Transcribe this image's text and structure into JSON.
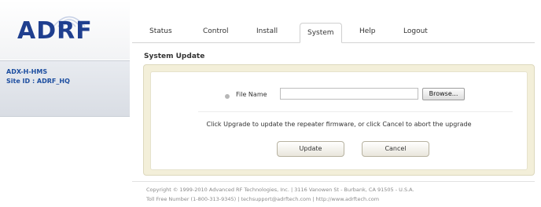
{
  "brand": {
    "logo_text": "ADRF",
    "accent_color": "#1f3f8f"
  },
  "site": {
    "device": "ADX-H-HMS",
    "site_id": "Site ID : ADRF_HQ"
  },
  "tabs": [
    {
      "label": "Status"
    },
    {
      "label": "Control"
    },
    {
      "label": "Install"
    },
    {
      "label": "System",
      "active": true
    },
    {
      "label": "Help"
    },
    {
      "label": "Logout"
    }
  ],
  "page": {
    "section_title": "System Update"
  },
  "update": {
    "file_label": "File Name",
    "file_value": "",
    "browse_label": "Browse...",
    "message": "Click Upgrade to update the repeater firmware, or click Cancel to abort the upgrade",
    "update_label": "Update",
    "cancel_label": "Cancel"
  },
  "footer": {
    "line1": "Copyright © 1999-2010 Advanced RF Technologies, Inc. | 3116 Vanowen St - Burbank, CA 91505 - U.S.A.",
    "line2": "Toll Free Number (1-800-313-9345) | techsupport@adrftech.com | http://www.adrftech.com"
  }
}
